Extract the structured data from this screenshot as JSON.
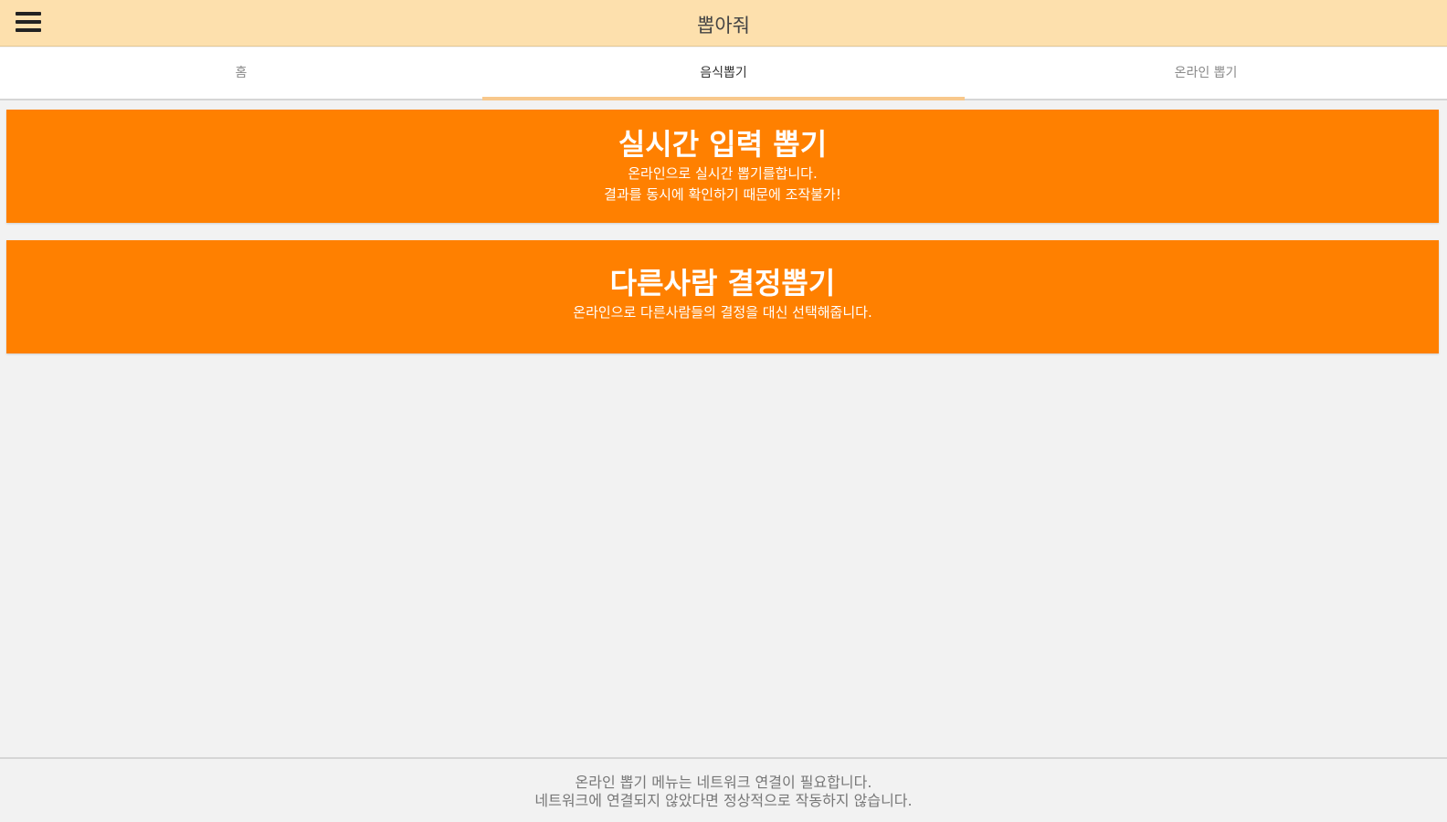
{
  "header": {
    "title": "뽑아줘",
    "menu_icon": "hamburger-menu-icon"
  },
  "tabs": [
    {
      "label": "홈",
      "active": false
    },
    {
      "label": "음식뽑기",
      "active": true
    },
    {
      "label": "온라인 뽑기",
      "active": false
    }
  ],
  "cards": [
    {
      "title": "실시간 입력 뽑기",
      "desc_line1": "온라인으로 실시간 뽑기를합니다.",
      "desc_line2": "결과를 동시에 확인하기 때문에 조작불가!"
    },
    {
      "title": "다른사람 결정뽑기",
      "desc_line1": "온라인으로 다른사람들의 결정을 대신 선택해줍니다."
    }
  ],
  "footer": {
    "line1": "온라인 뽑기 메뉴는 네트워크 연결이 필요합니다.",
    "line2": "네트워크에 연결되지 않았다면 정상적으로 작동하지 않습니다."
  },
  "colors": {
    "appbar": "#fde0ad",
    "accent": "#ff8000",
    "tab_indicator": "#f8c88c",
    "background": "#f2f2f2"
  }
}
